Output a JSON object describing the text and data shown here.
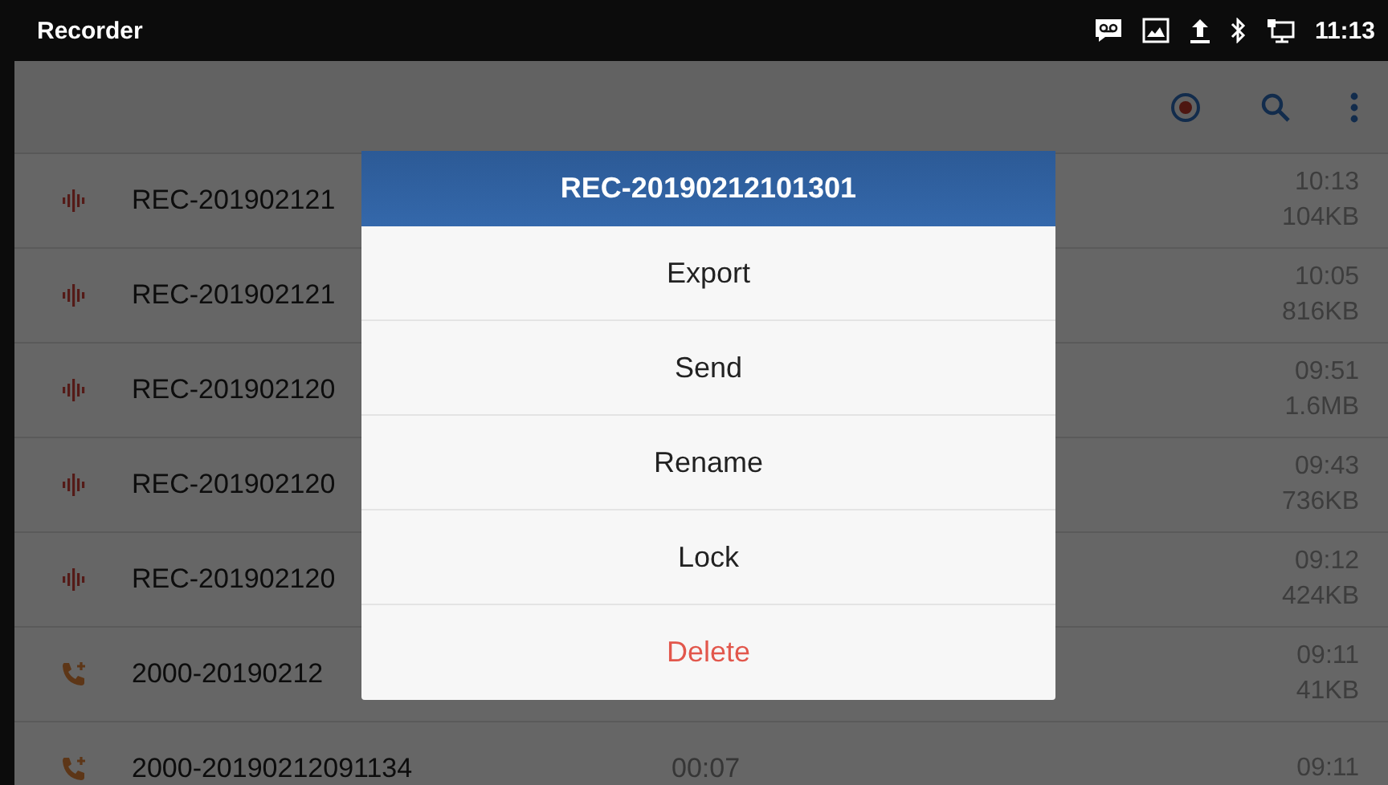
{
  "status_bar": {
    "app_title": "Recorder",
    "time": "11:13"
  },
  "recordings": [
    {
      "kind": "recording",
      "name": "REC-201902121",
      "time": "10:13",
      "size": "104KB"
    },
    {
      "kind": "recording",
      "name": "REC-201902121",
      "time": "10:05",
      "size": "816KB"
    },
    {
      "kind": "recording",
      "name": "REC-201902120",
      "time": "09:51",
      "size": "1.6MB"
    },
    {
      "kind": "recording",
      "name": "REC-201902120",
      "time": "09:43",
      "size": "736KB"
    },
    {
      "kind": "recording",
      "name": "REC-201902120",
      "time": "09:12",
      "size": "424KB"
    },
    {
      "kind": "call",
      "name": "2000-20190212",
      "time": "09:11",
      "size": "41KB"
    },
    {
      "kind": "call",
      "name": "2000-20190212091134",
      "duration": "00:07",
      "time": "09:11"
    }
  ],
  "dialog": {
    "title": "REC-20190212101301",
    "options": [
      {
        "label": "Export",
        "kind": "normal"
      },
      {
        "label": "Send",
        "kind": "normal"
      },
      {
        "label": "Rename",
        "kind": "normal"
      },
      {
        "label": "Lock",
        "kind": "normal"
      },
      {
        "label": "Delete",
        "kind": "danger"
      }
    ]
  }
}
